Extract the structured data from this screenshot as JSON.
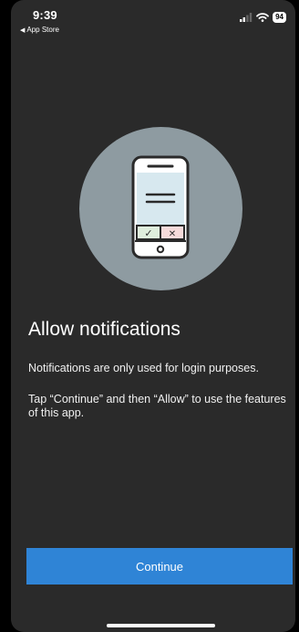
{
  "status_bar": {
    "time": "9:39",
    "back_label": "App Store",
    "battery": "94"
  },
  "illustration": {
    "name": "phone-notification-illustration",
    "check_glyph": "✓",
    "cross_glyph": "✕",
    "colors": {
      "circle": "#8e9ba1",
      "screen": "#d7e8ef",
      "accept": "#dfeedd",
      "decline": "#f5dada",
      "outline": "#2a2a2a"
    }
  },
  "main": {
    "title": "Allow notifications",
    "paragraph_1": "Notifications are only used for login purposes.",
    "paragraph_2": "Tap “Continue” and then “Allow” to use the features of this app."
  },
  "actions": {
    "continue_label": "Continue",
    "accent_color": "#2f84d6"
  }
}
